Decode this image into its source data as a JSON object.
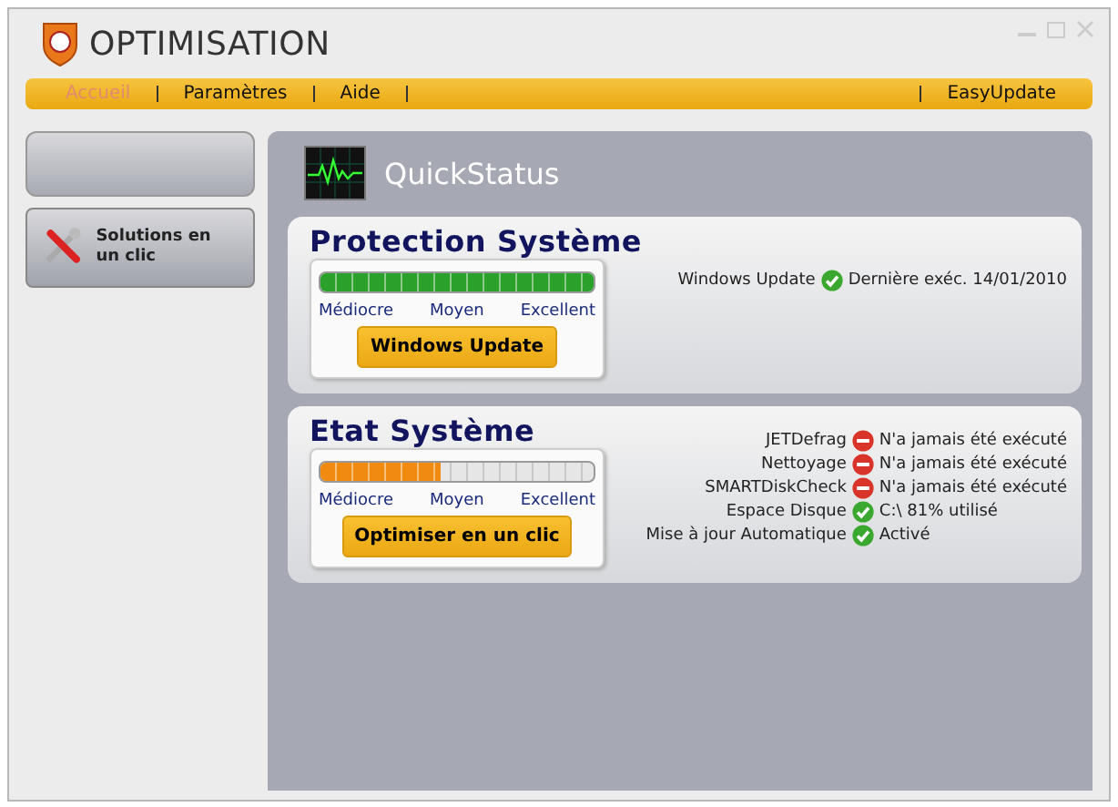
{
  "window": {
    "title": "OPTIMISATION"
  },
  "menu": [
    {
      "label": "Accueil",
      "selected": true
    },
    {
      "label": "Paramètres",
      "selected": false
    },
    {
      "label": "Aide",
      "selected": false
    }
  ],
  "menu_right": {
    "label": "EasyUpdate"
  },
  "sidebar": {
    "items": [
      {
        "label": "Solutions en un clic"
      }
    ]
  },
  "main": {
    "title": "QuickStatus"
  },
  "sections": [
    {
      "title": "Protection Système",
      "meter": {
        "level": 1,
        "color": "#2aa12a",
        "labels": [
          "Médiocre",
          "Moyen",
          "Excellent"
        ]
      },
      "button": "Windows Update",
      "status": [
        {
          "name": "Windows Update",
          "kind": "ok",
          "value": "Dernière exéc. 14/01/2010"
        }
      ]
    },
    {
      "title": "Etat Système",
      "meter": {
        "level": 0.44,
        "color": "#f08a10",
        "labels": [
          "Médiocre",
          "Moyen",
          "Excellent"
        ]
      },
      "button": "Optimiser en un clic",
      "status": [
        {
          "name": "JETDefrag",
          "kind": "error",
          "value": "N'a jamais été exécuté"
        },
        {
          "name": "Nettoyage",
          "kind": "error",
          "value": "N'a jamais été exécuté"
        },
        {
          "name": "SMARTDiskCheck",
          "kind": "error",
          "value": "N'a jamais été exécuté"
        },
        {
          "name": "Espace Disque",
          "kind": "ok",
          "value": "C:\\ 81% utilisé"
        },
        {
          "name": "Mise à jour Automatique",
          "kind": "ok",
          "value": "Activé"
        }
      ]
    }
  ]
}
